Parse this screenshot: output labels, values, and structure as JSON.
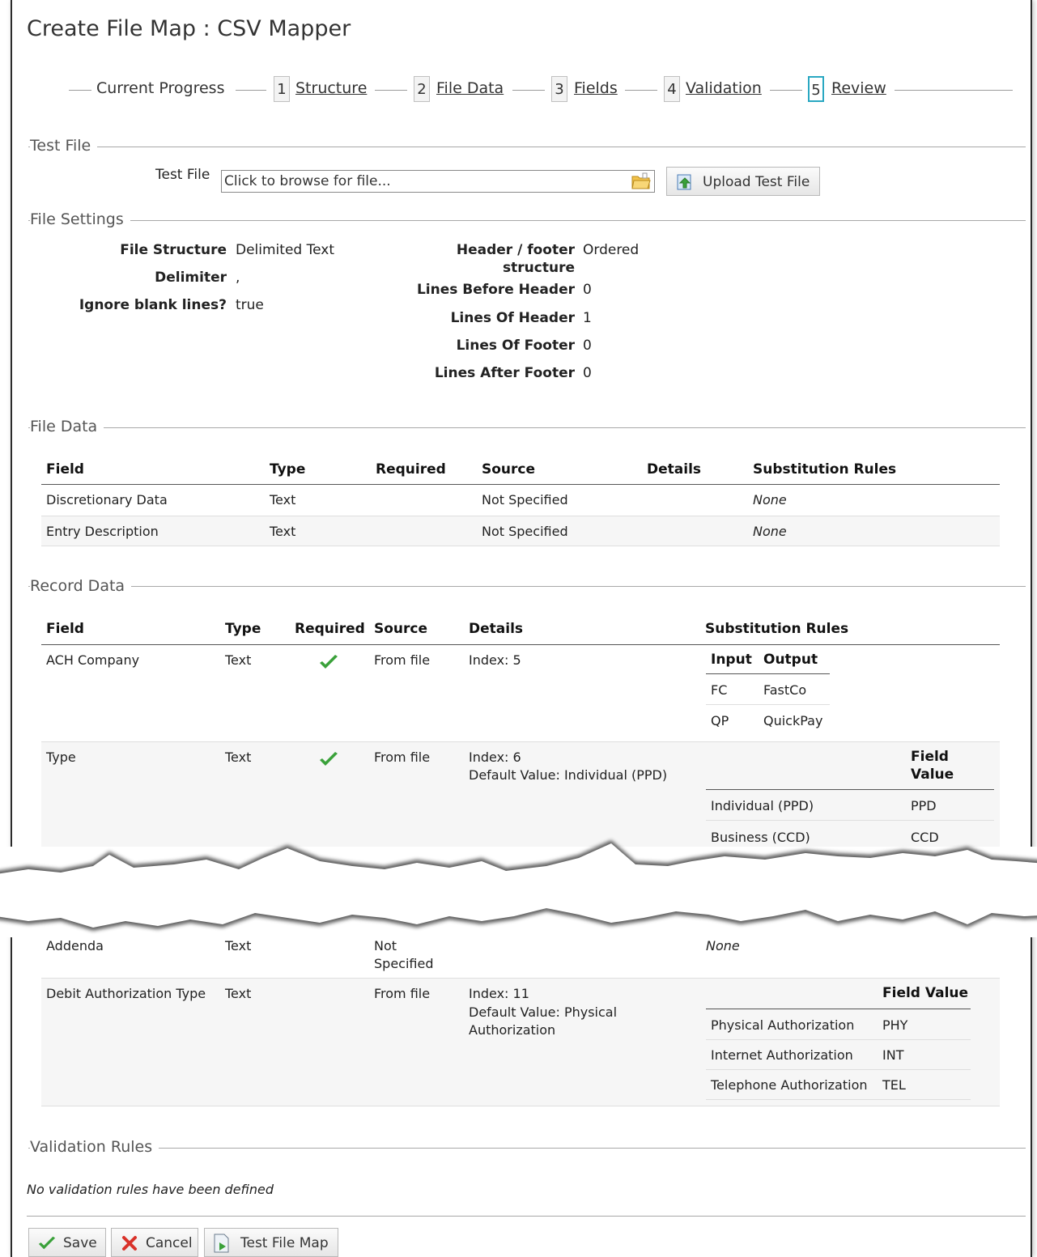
{
  "page": {
    "title": "Create File Map : CSV Mapper"
  },
  "progress": {
    "label": "Current Progress",
    "steps": [
      {
        "num": "1",
        "label": "Structure"
      },
      {
        "num": "2",
        "label": "File Data"
      },
      {
        "num": "3",
        "label": "Fields"
      },
      {
        "num": "4",
        "label": "Validation"
      },
      {
        "num": "5",
        "label": "Review"
      }
    ]
  },
  "test_file": {
    "section": "Test File",
    "label": "Test File",
    "placeholder": "Click to browse for file...",
    "upload_label": "Upload Test File"
  },
  "file_settings": {
    "section": "File Settings",
    "left": [
      {
        "label": "File Structure",
        "value": "Delimited Text"
      },
      {
        "label": "Delimiter",
        "value": ","
      },
      {
        "label": "Ignore blank lines?",
        "value": "true"
      }
    ],
    "right": [
      {
        "label": "Header / footer structure",
        "label_line1": "Header / footer",
        "label_line2": "structure",
        "value": "Ordered"
      },
      {
        "label": "Lines Before Header",
        "value": "0"
      },
      {
        "label": "Lines Of Header",
        "value": "1"
      },
      {
        "label": "Lines Of Footer",
        "value": "0"
      },
      {
        "label": "Lines After Footer",
        "value": "0"
      }
    ]
  },
  "file_data": {
    "section": "File Data",
    "headers": [
      "Field",
      "Type",
      "Required",
      "Source",
      "Details",
      "Substitution Rules"
    ],
    "rows": [
      {
        "field": "Discretionary Data",
        "type": "Text",
        "required": "",
        "source": "Not Specified",
        "details": "",
        "rules": "None"
      },
      {
        "field": "Entry Description",
        "type": "Text",
        "required": "",
        "source": "Not Specified",
        "details": "",
        "rules": "None"
      }
    ]
  },
  "record_data": {
    "section": "Record Data",
    "headers": [
      "Field",
      "Type",
      "Required",
      "Source",
      "Details",
      "Substitution Rules"
    ],
    "rows": [
      {
        "field": "ACH Company",
        "type": "Text",
        "required": true,
        "source": "From file",
        "details": [
          "Index: 5"
        ],
        "rules": {
          "input_header": "Input",
          "output_header": "Output",
          "items": [
            {
              "input": "FC",
              "output": "FastCo"
            },
            {
              "input": "QP",
              "output": "QuickPay"
            }
          ]
        }
      },
      {
        "field": "Type",
        "type": "Text",
        "required": true,
        "source": "From file",
        "details": [
          "Index: 6",
          "Default Value: Individual (PPD)"
        ],
        "rules": {
          "header_line1": "Field",
          "header_line2": "Value",
          "items": [
            {
              "field": "Individual (PPD)",
              "value": "PPD"
            },
            {
              "field": "Business (CCD)",
              "value": "CCD"
            }
          ]
        }
      },
      {
        "field": "Addenda",
        "type": "Text",
        "required": false,
        "source_line1": "Not",
        "source_line2": "Specified",
        "details": [],
        "rules": "None"
      },
      {
        "field": "Debit Authorization Type",
        "type": "Text",
        "required": false,
        "source": "From file",
        "details": [
          "Index: 11",
          "Default Value: Physical",
          "Authorization"
        ],
        "rules": {
          "header": "Field Value",
          "items": [
            {
              "field": "Physical Authorization",
              "value": "PHY"
            },
            {
              "field": "Internet Authorization",
              "value": "INT"
            },
            {
              "field": "Telephone Authorization",
              "value": "TEL"
            }
          ]
        }
      }
    ]
  },
  "validation": {
    "section": "Validation Rules",
    "empty_message": "No validation rules have been defined"
  },
  "actions": {
    "save": "Save",
    "cancel": "Cancel",
    "test": "Test File Map"
  },
  "colors": {
    "accent": "#2aa8c2",
    "check": "#3aa13a",
    "cancel": "#d9322a"
  }
}
